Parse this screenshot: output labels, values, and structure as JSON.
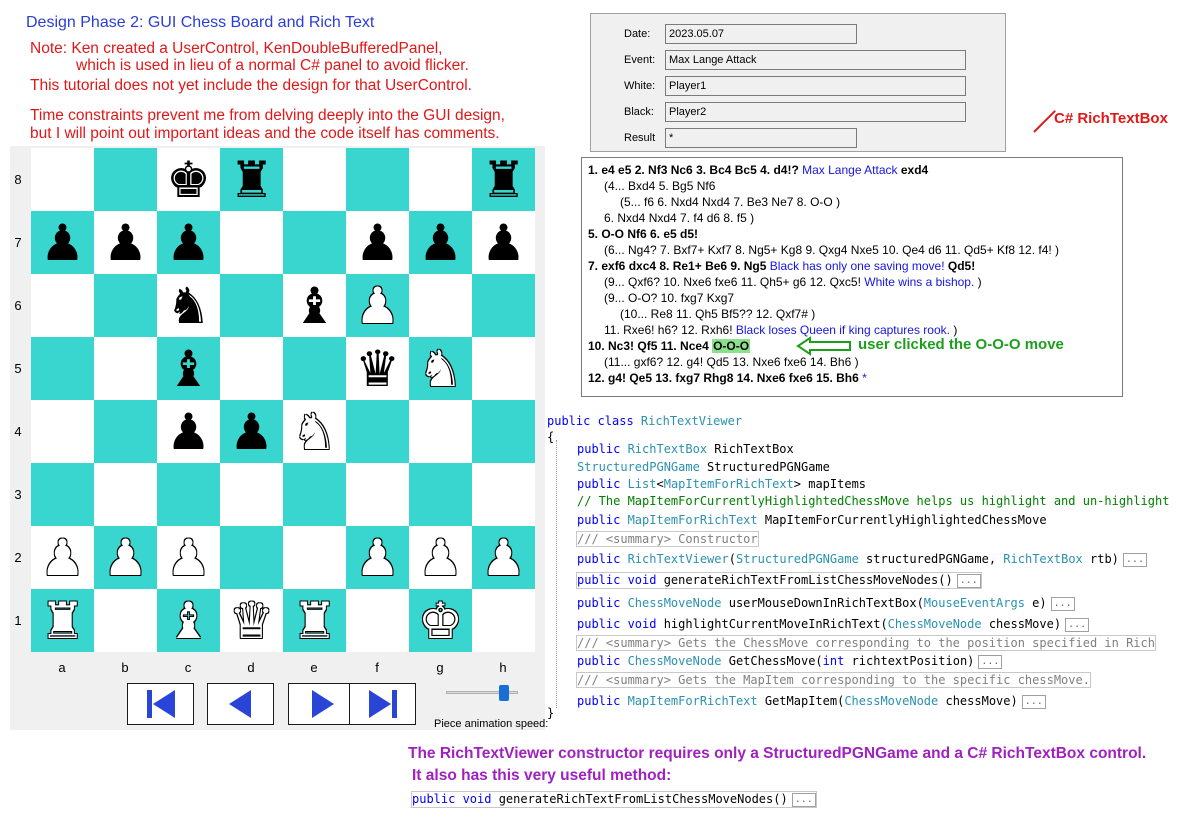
{
  "heading": "Design Phase 2: GUI Chess Board and Rich Text",
  "notes": [
    "Note: Ken created a UserControl, KenDoubleBufferedPanel,",
    "which is used in lieu of a normal C# panel to avoid flicker.",
    "This tutorial does not yet include the design for that UserControl.",
    "Time constraints prevent me from delving deeply into the GUI design,",
    "but I will point out important ideas and the code itself has comments."
  ],
  "game_header": {
    "date_label": "Date:",
    "date": "2023.05.07",
    "event_label": "Event:",
    "event": "Max Lange Attack",
    "white_label": "White:",
    "white": "Player1",
    "black_label": "Black:",
    "black": "Player2",
    "result_label": "Result",
    "result": "*"
  },
  "rtb_label": "C# RichTextBox",
  "rich_text": {
    "l1a": "1. e4  e5  2. Nf3  Nc6  3. Bc4  Bc5  4. d4!?",
    "l1b": "Max Lange Attack",
    "l1c": "exd4",
    "l2": "(4... Bxd4  5. Bg5  Nf6",
    "l3": "(5... f6  6. Nxd4  Nxd4  7. Be3  Ne7  8. O-O  )",
    "l4": "6. Nxd4  Nxd4  7. f4  d6  8. f5  )",
    "l5": "5. O-O  Nf6  6. e5  d5!",
    "l6": "(6... Ng4?  7. Bxf7+  Kxf7  8. Ng5+  Kg8  9. Qxg4  Nxe5  10. Qe4  d6  11. Qd5+  Kf8  12. f4!  )",
    "l7a": "7. exf6  dxc4  8. Re1+  Be6  9. Ng5",
    "l7b": "Black has only  one saving move!",
    "l7c": "Qd5!",
    "l8a": "(9... Qxf6?  10. Nxe6  fxe6  11. Qh5+  g6  12. Qxc5!",
    "l8b": "White wins a bishop.",
    "l8c": ")",
    "l9": "(9... O-O?  10. fxg7  Kxg7",
    "l10": "(10... Re8  11. Qh5  Bf5??  12. Qxf7#  )",
    "l11a": "11. Rxe6!  h6?  12. Rxh6!",
    "l11b": "Black loses Queen if king captures  rook.",
    "l11c": ")",
    "l12a": "10. Nc3!  Qf5  11. Nce4",
    "l12b": "O-O-O",
    "l13": "(11... gxf6?  12. g4!  Qd5  13. Nxe6  fxe6  14. Bh6  )",
    "l14a": "12. g4!  Qe5  13. fxg7  Rhg8  14. Nxe6  fxe6  15. Bh6",
    "l14b": "*"
  },
  "clicked_note": "user clicked the O-O-O move",
  "board": {
    "rows": [
      [
        "",
        "",
        "♚b",
        "♜b",
        "",
        "",
        "",
        "♜b"
      ],
      [
        "♟b",
        "♟b",
        "♟b",
        "",
        "",
        "♟b",
        "♟b",
        "♟b"
      ],
      [
        "",
        "",
        "♞b",
        "",
        "♝b",
        "♙w",
        "",
        ""
      ],
      [
        "",
        "",
        "♝b",
        "",
        "",
        "♛b",
        "♘w",
        ""
      ],
      [
        "",
        "",
        "♟b",
        "♟b",
        "♘w",
        "",
        "",
        ""
      ],
      [
        "",
        "",
        "",
        "",
        "",
        "",
        "",
        ""
      ],
      [
        "♙w",
        "♙w",
        "♙w",
        "",
        "",
        "♙w",
        "♙w",
        "♙w"
      ],
      [
        "♖w",
        "",
        "♗w",
        "♕w",
        "♖w",
        "",
        "♔w",
        ""
      ]
    ],
    "ranks": [
      "8",
      "7",
      "6",
      "5",
      "4",
      "3",
      "2",
      "1"
    ],
    "files": [
      "a",
      "b",
      "c",
      "d",
      "e",
      "f",
      "g",
      "h"
    ],
    "speed_label": "Piece animation speed:",
    "speed_level": 0.8
  },
  "code": {
    "l1": "public class RichTextViewer",
    "l2": "{",
    "l3": "public RichTextBox RichTextBox",
    "l4": "StructuredPGNGame StructuredPGNGame",
    "l5": "public List<MapItemForRichText> mapItems",
    "l6": "// The MapItemForCurrentlyHighlightedChessMove helps us highlight and un-highlight",
    "l7": "public MapItemForRichText MapItemForCurrentlyHighlightedChessMove",
    "l8": "/// <summary> Constructor",
    "l9": "public RichTextViewer(StructuredPGNGame structuredPGNGame, RichTextBox rtb)",
    "l10": "public void generateRichTextFromListChessMoveNodes()",
    "l11": "public ChessMoveNode userMouseDownInRichTextBox(MouseEventArgs e)",
    "l12": "public void highlightCurrentMoveInRichText(ChessMoveNode chessMove)",
    "l13": "/// <summary> Gets the ChessMove corresponding to the position specified in Rich",
    "l14": "public ChessMoveNode GetChessMove(int richtextPosition)",
    "l15": "/// <summary> Gets the MapItem corresponding to the specific chessMove.",
    "l16": "public MapItemForRichText GetMapItem(ChessMoveNode chessMove)",
    "l17": "}",
    "ellipsis": "..."
  },
  "bottom": {
    "line1": "The RichTextViewer constructor requires only a StructuredPGNGame and a C# RichTextBox control.",
    "line2": "It also has this very useful method:",
    "method": "public void generateRichTextFromListChessMoveNodes()"
  }
}
